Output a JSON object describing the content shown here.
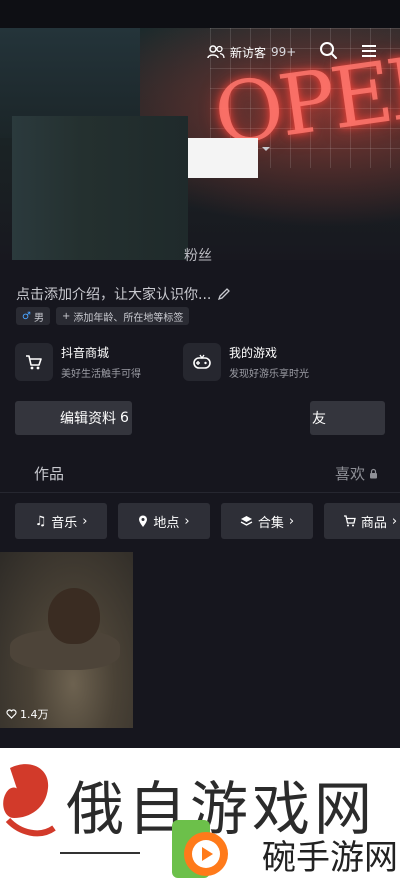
{
  "header": {
    "visitors_label": "新访客",
    "visitors_count": "99+",
    "cover_word": "OPEN"
  },
  "profile": {
    "fans_label": "粉丝",
    "bio_placeholder": "点击添加介绍，让大家认识你...",
    "gender_tag": "男",
    "add_tags_label": "添加年龄、所在地等标签"
  },
  "services": [
    {
      "title": "抖音商城",
      "subtitle": "美好生活触手可得"
    },
    {
      "title": "我的游戏",
      "subtitle": "发现好游乐享时光"
    }
  ],
  "actions": {
    "edit_profile": "编辑资料",
    "edit_profile_suffix": "6",
    "add_friend_suffix": "友"
  },
  "tabs": {
    "works": "作品",
    "likes": "喜欢"
  },
  "chips": [
    "音乐",
    "地点",
    "合集",
    "商品"
  ],
  "video": {
    "likes": "1.4万"
  },
  "watermark": {
    "title": "俄自游戏网",
    "subtitle": "碗手游网"
  },
  "colors": {
    "background": "#16161e",
    "card": "#2e2f37",
    "neon": "#ff6a5a"
  }
}
